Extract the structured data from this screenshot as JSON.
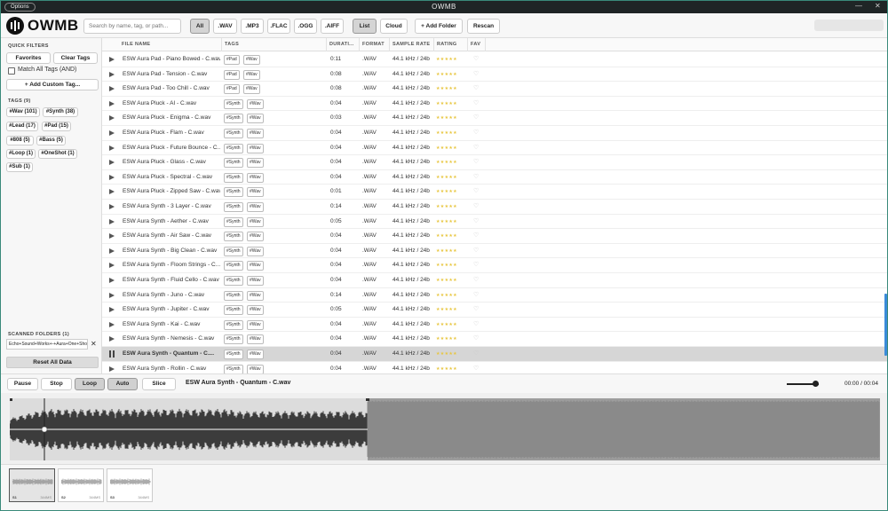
{
  "window": {
    "title": "OWMB",
    "options_label": "Options",
    "minimize": "—",
    "close": "✕"
  },
  "toolbar": {
    "logo": "OWMB",
    "search_placeholder": "Search by name, tag, or path...",
    "format_filters": [
      "All",
      ".WAV",
      ".MP3",
      ".FLAC",
      ".OGG",
      ".AIFF"
    ],
    "view_modes": [
      "List",
      "Cloud"
    ],
    "add_folder": "+ Add Folder",
    "rescan": "Rescan"
  },
  "sidebar": {
    "quick_filters_title": "QUICK FILTERS",
    "favorites": "Favorites",
    "clear_tags": "Clear Tags",
    "match_all": "Match All Tags (AND)",
    "add_custom_tag": "+ Add Custom Tag...",
    "tags_title": "TAGS (9)",
    "tags": [
      "#Wav (101)",
      "#Synth (38)",
      "#Lead (17)",
      "#Pad (15)",
      "#808 (5)",
      "#Bass (5)",
      "#Loop (1)",
      "#OneShot (1)",
      "#Sub (1)"
    ],
    "scanned_title": "SCANNED FOLDERS (1)",
    "folder": "Echo+Sound+Works+-+Aura+One+Shots",
    "folder_remove": "✕",
    "reset": "Reset All Data"
  },
  "table": {
    "columns": [
      "FILE NAME",
      "TAGS",
      "DURATI...",
      "FORMAT",
      "SAMPLE RATE",
      "RATING",
      "FAV"
    ],
    "rating_stars": "★★★★★",
    "fav_icon": "♡",
    "rows": [
      {
        "name": "ESW Aura Pad - Piano Bowed - C.wav",
        "tags": [
          "#Pad",
          "#Wav"
        ],
        "duration": "0:11",
        "format": ".WAV",
        "rate": "44.1 kHz / 24b"
      },
      {
        "name": "ESW Aura Pad - Tension - C.wav",
        "tags": [
          "#Pad",
          "#Wav"
        ],
        "duration": "0:08",
        "format": ".WAV",
        "rate": "44.1 kHz / 24b"
      },
      {
        "name": "ESW Aura Pad - Too Chill - C.wav",
        "tags": [
          "#Pad",
          "#Wav"
        ],
        "duration": "0:08",
        "format": ".WAV",
        "rate": "44.1 kHz / 24b"
      },
      {
        "name": "ESW Aura Pluck - AI - C.wav",
        "tags": [
          "#Synth",
          "#Wav"
        ],
        "duration": "0:04",
        "format": ".WAV",
        "rate": "44.1 kHz / 24b"
      },
      {
        "name": "ESW Aura Pluck - Enigma - C.wav",
        "tags": [
          "#Synth",
          "#Wav"
        ],
        "duration": "0:03",
        "format": ".WAV",
        "rate": "44.1 kHz / 24b"
      },
      {
        "name": "ESW Aura Pluck - Flam - C.wav",
        "tags": [
          "#Synth",
          "#Wav"
        ],
        "duration": "0:04",
        "format": ".WAV",
        "rate": "44.1 kHz / 24b"
      },
      {
        "name": "ESW Aura Pluck - Future Bounce - C...",
        "tags": [
          "#Synth",
          "#Wav"
        ],
        "duration": "0:04",
        "format": ".WAV",
        "rate": "44.1 kHz / 24b"
      },
      {
        "name": "ESW Aura Pluck - Glass - C.wav",
        "tags": [
          "#Synth",
          "#Wav"
        ],
        "duration": "0:04",
        "format": ".WAV",
        "rate": "44.1 kHz / 24b"
      },
      {
        "name": "ESW Aura Pluck - Spectral - C.wav",
        "tags": [
          "#Synth",
          "#Wav"
        ],
        "duration": "0:04",
        "format": ".WAV",
        "rate": "44.1 kHz / 24b"
      },
      {
        "name": "ESW Aura Pluck - Zipped Saw - C.wav",
        "tags": [
          "#Synth",
          "#Wav"
        ],
        "duration": "0:01",
        "format": ".WAV",
        "rate": "44.1 kHz / 24b"
      },
      {
        "name": "ESW Aura Synth - 3 Layer - C.wav",
        "tags": [
          "#Synth",
          "#Wav"
        ],
        "duration": "0:14",
        "format": ".WAV",
        "rate": "44.1 kHz / 24b"
      },
      {
        "name": "ESW Aura Synth - Aether - C.wav",
        "tags": [
          "#Synth",
          "#Wav"
        ],
        "duration": "0:05",
        "format": ".WAV",
        "rate": "44.1 kHz / 24b"
      },
      {
        "name": "ESW Aura Synth - Air Saw - C.wav",
        "tags": [
          "#Synth",
          "#Wav"
        ],
        "duration": "0:04",
        "format": ".WAV",
        "rate": "44.1 kHz / 24b"
      },
      {
        "name": "ESW Aura Synth - Big Clean - C.wav",
        "tags": [
          "#Synth",
          "#Wav"
        ],
        "duration": "0:04",
        "format": ".WAV",
        "rate": "44.1 kHz / 24b"
      },
      {
        "name": "ESW Aura Synth - Floom Strings - C...",
        "tags": [
          "#Synth",
          "#Wav"
        ],
        "duration": "0:04",
        "format": ".WAV",
        "rate": "44.1 kHz / 24b"
      },
      {
        "name": "ESW Aura Synth - Fluid Cello - C.wav",
        "tags": [
          "#Synth",
          "#Wav"
        ],
        "duration": "0:04",
        "format": ".WAV",
        "rate": "44.1 kHz / 24b"
      },
      {
        "name": "ESW Aura Synth - Juno - C.wav",
        "tags": [
          "#Synth",
          "#Wav"
        ],
        "duration": "0:14",
        "format": ".WAV",
        "rate": "44.1 kHz / 24b"
      },
      {
        "name": "ESW Aura Synth - Jupiter - C.wav",
        "tags": [
          "#Synth",
          "#Wav"
        ],
        "duration": "0:05",
        "format": ".WAV",
        "rate": "44.1 kHz / 24b"
      },
      {
        "name": "ESW Aura Synth - Kai - C.wav",
        "tags": [
          "#Synth",
          "#Wav"
        ],
        "duration": "0:04",
        "format": ".WAV",
        "rate": "44.1 kHz / 24b"
      },
      {
        "name": "ESW Aura Synth - Nemesis - C.wav",
        "tags": [
          "#Synth",
          "#Wav"
        ],
        "duration": "0:04",
        "format": ".WAV",
        "rate": "44.1 kHz / 24b"
      },
      {
        "name": "ESW Aura Synth - Quantum - C....",
        "tags": [
          "#Synth",
          "#Wav"
        ],
        "duration": "0:04",
        "format": ".WAV",
        "rate": "44.1 kHz / 24b",
        "selected": true
      },
      {
        "name": "ESW Aura Synth - Rollin - C.wav",
        "tags": [
          "#Synth",
          "#Wav"
        ],
        "duration": "0:04",
        "format": ".WAV",
        "rate": "44.1 kHz / 24b"
      }
    ]
  },
  "transport": {
    "buttons": [
      "Pause",
      "Stop",
      "Loop",
      "Auto",
      "Slice"
    ],
    "now_playing": "ESW Aura Synth - Quantum - C.wav",
    "volume": 0.8,
    "time": "00:00 / 00:04"
  },
  "slices": [
    {
      "index": "S1",
      "length": "344MS"
    },
    {
      "index": "S2",
      "length": "344MS"
    },
    {
      "index": "S3",
      "length": "344MS"
    }
  ]
}
